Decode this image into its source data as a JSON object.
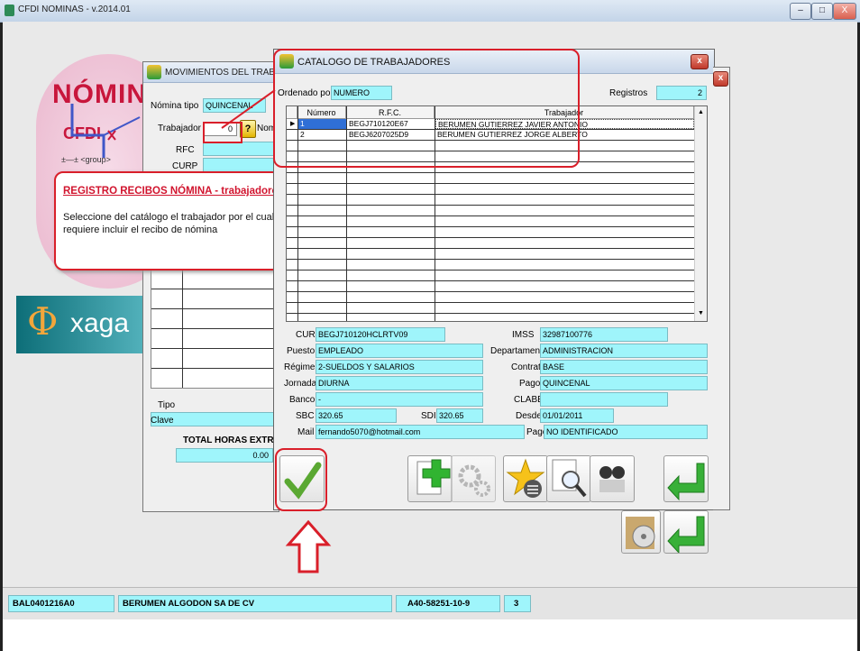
{
  "window": {
    "title": "CFDI NOMINAS - v.2014.01"
  },
  "background": {
    "logo_title": "NÓMINA",
    "logo_sub": "CFDI",
    "group_label": "<group>",
    "brand": "xaga"
  },
  "movimientos": {
    "title": "MOVIMIENTOS DEL TRABAJA",
    "nomina_tipo_label": "Nómina tipo",
    "nomina_tipo_value": "QUINCENAL",
    "trabajador_label": "Trabajador",
    "trabajador_value": "0",
    "nombre_label": "Nombre",
    "rfc_label": "RFC",
    "curp_label": "CURP",
    "tipo_label": "Tipo",
    "clave_label": "Clave",
    "total_horas_label": "TOTAL HORAS EXTRAS",
    "total_horas_value": "0.00"
  },
  "catalog": {
    "title": "CATALOGO DE TRABAJADORES",
    "close": "x",
    "ordenado_label": "Ordenado por",
    "ordenado_value": "NUMERO",
    "registros_label": "Registros",
    "registros_value": "2",
    "columns": [
      "Número",
      "R.F.C.",
      "Trabajador"
    ],
    "rows": [
      {
        "numero": "1",
        "rfc": "BEGJ710120E67",
        "trabajador": "BERUMEN GUTIERREZ JAVIER ANTONIO"
      },
      {
        "numero": "2",
        "rfc": "BEGJ6207025D9",
        "trabajador": "BERUMEN GUTIERREZ JORGE ALBERTO"
      }
    ],
    "details": {
      "curp_label": "CURP",
      "curp": "BEGJ710120HCLRTV09",
      "imss_label": "IMSS",
      "imss": "32987100776",
      "puesto_label": "Puesto",
      "puesto": "EMPLEADO",
      "departamento_label": "Departamento",
      "departamento": "ADMINISTRACION",
      "regimen_label": "Régimen",
      "regimen": "2-SUELDOS Y SALARIOS",
      "contrato_label": "Contrato",
      "contrato": "BASE",
      "jornada_label": "Jornada",
      "jornada": "DIURNA",
      "pago_label": "Pago",
      "pago": "QUINCENAL",
      "banco_label": "Banco",
      "banco": "-",
      "clabe_label": "CLABE",
      "clabe": "",
      "sbc_label": "SBC",
      "sbc": "320.65",
      "sdi_label": "SDI",
      "sdi": "320.65",
      "desde_label": "Desde",
      "desde": "01/01/2011",
      "mail_label": "Mail",
      "mail": "fernando5070@hotmail.com",
      "pago2_label": "Pago",
      "pago2": "NO IDENTIFICADO"
    }
  },
  "callout": {
    "heading": "REGISTRO RECIBOS NÓMINA - trabajadores",
    "body": "Seleccione del catálogo el trabajador por el cual requiere incluir el recibo de nómina"
  },
  "status": {
    "rfc": "BAL0401216A0",
    "company": "BERUMEN ALGODON SA DE CV",
    "code": "A40-58251-10-9",
    "number": "3"
  },
  "colors": {
    "field": "#9ff5fb",
    "accent_red": "#d91f2a"
  }
}
